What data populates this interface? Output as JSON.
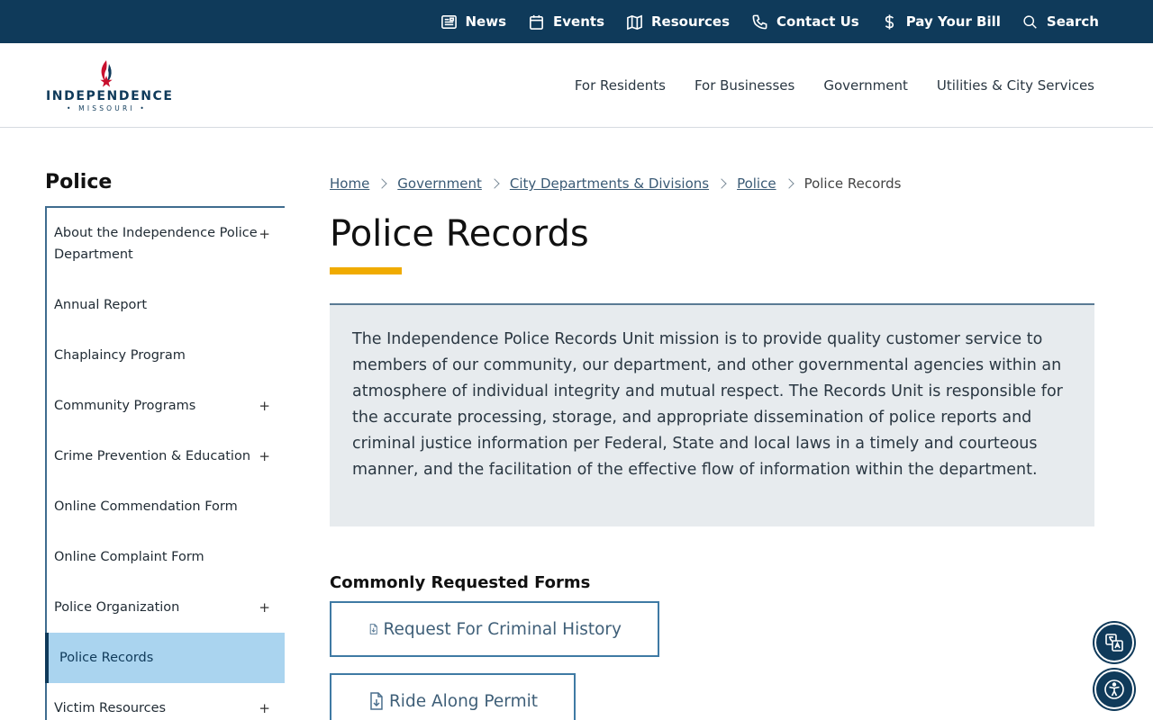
{
  "topnav": {
    "items": [
      {
        "label": "News",
        "icon": "newspaper-icon"
      },
      {
        "label": "Events",
        "icon": "calendar-icon"
      },
      {
        "label": "Resources",
        "icon": "map-icon"
      },
      {
        "label": "Contact Us",
        "icon": "phone-icon"
      },
      {
        "label": "Pay Your Bill",
        "icon": "dollar-icon"
      },
      {
        "label": "Search",
        "icon": "search-icon"
      }
    ]
  },
  "header": {
    "logo": {
      "name": "INDEPENDENCE",
      "state": "• MISSOURI •"
    },
    "nav": [
      "For Residents",
      "For Businesses",
      "Government",
      "Utilities & City Services"
    ]
  },
  "sidebar": {
    "title": "Police",
    "items": [
      {
        "label": "About the Independence Police Department",
        "expandable": "+"
      },
      {
        "label": "Annual Report",
        "expandable": ""
      },
      {
        "label": "Chaplaincy Program",
        "expandable": ""
      },
      {
        "label": "Community Programs",
        "expandable": "+"
      },
      {
        "label": "Crime Prevention & Education",
        "expandable": "+"
      },
      {
        "label": "Online Commendation Form",
        "expandable": ""
      },
      {
        "label": "Online Complaint Form",
        "expandable": ""
      },
      {
        "label": "Police Organization",
        "expandable": "+"
      },
      {
        "label": "Police Records",
        "expandable": "",
        "active": true
      },
      {
        "label": "Victim Resources",
        "expandable": "+"
      }
    ]
  },
  "breadcrumb": {
    "links": [
      "Home",
      "Government",
      "City Departments & Divisions",
      "Police"
    ],
    "current": "Police Records"
  },
  "page": {
    "title": "Police Records",
    "mission": "The Independence Police Records Unit mission is to provide quality customer service to members of our community, our department, and other governmental agencies within an atmosphere of individual integrity and mutual respect. The Records Unit is responsible for the accurate processing, storage, and appropriate dissemination of police reports and criminal justice information per Federal, State and local laws in a timely and courteous manner, and the facilitation of the effective flow of information within the department.",
    "forms_heading": "Commonly Requested Forms",
    "forms": [
      "Request For Criminal History",
      "Ride Along Permit"
    ]
  },
  "colors": {
    "topbar": "#0f3a5a",
    "accent": "#f0ab00",
    "active_nav": "#aad4ef",
    "mission_bg": "#e7ebee"
  },
  "floating": {
    "translate_icon": "translate-icon",
    "accessibility_icon": "accessibility-icon"
  }
}
